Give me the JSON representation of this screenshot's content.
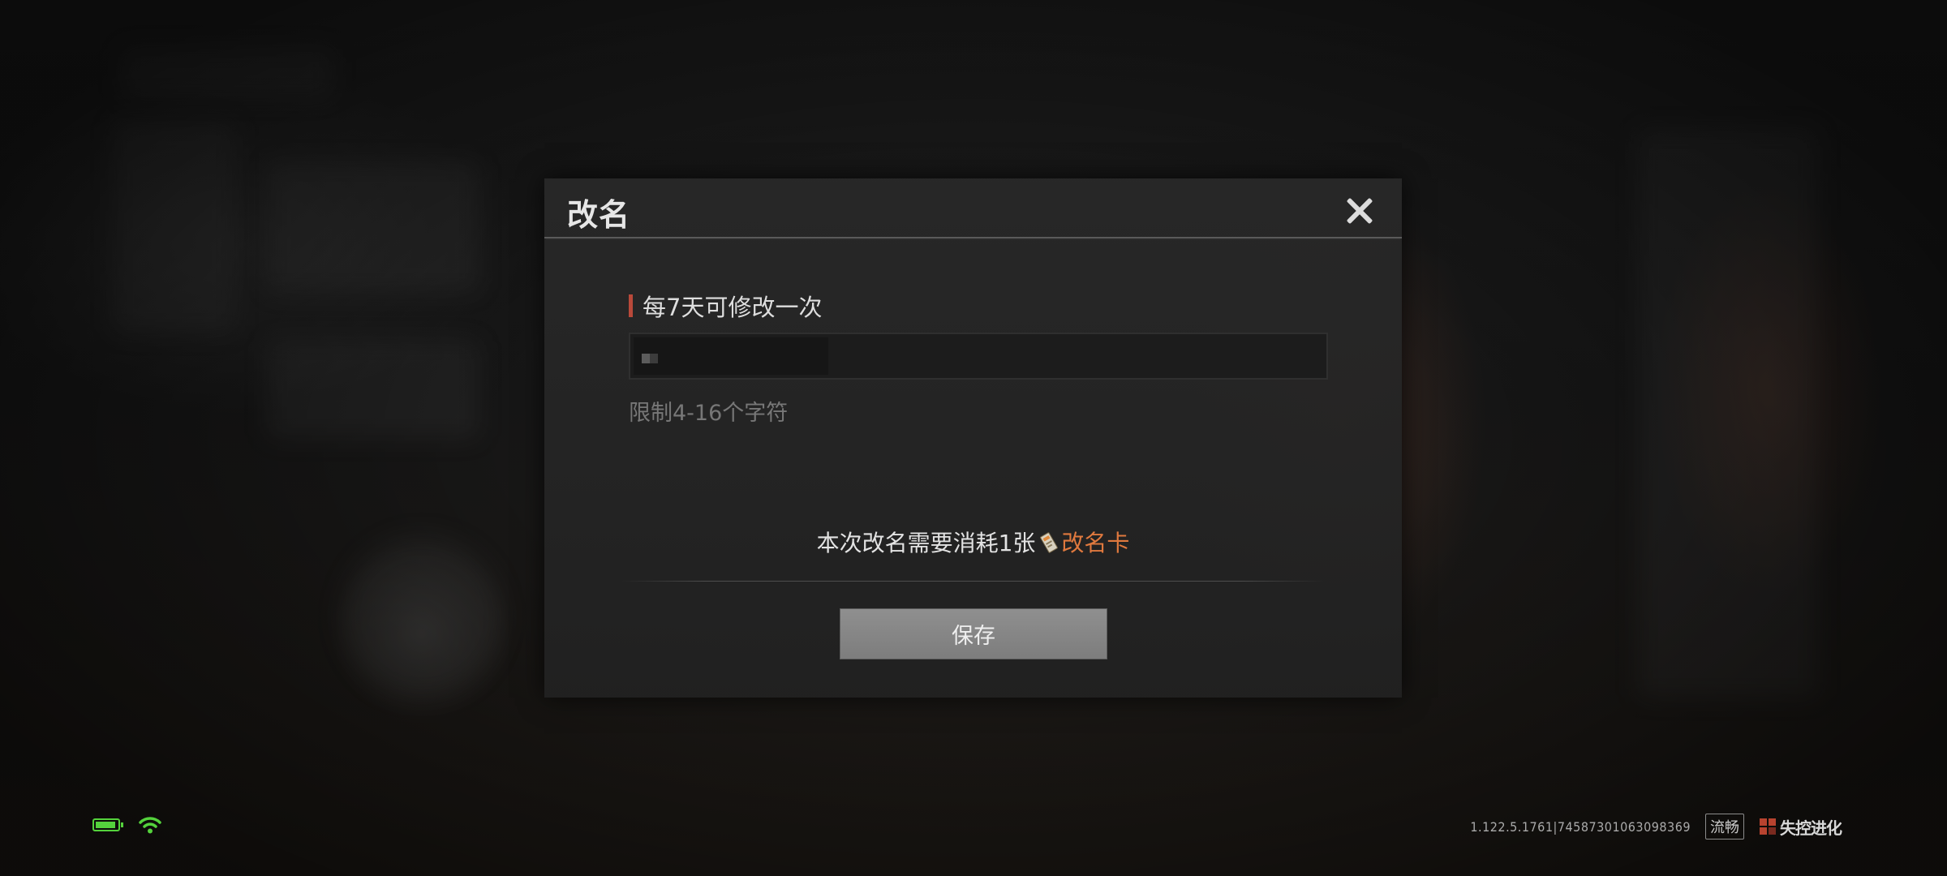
{
  "dialog": {
    "title": "改名",
    "close_icon": "close-icon",
    "field_label": "每7天可修改一次",
    "input_value": "",
    "hint": "限制4-16个字符",
    "cost_prefix": "本次改名需要消耗1张",
    "cost_item_icon": "rename-card-icon",
    "cost_item": "改名卡",
    "save_label": "保存"
  },
  "status": {
    "battery_icon": "battery-icon",
    "wifi_icon": "wifi-icon",
    "version": "1.122.5.1761|7458730106309836​9",
    "quality": "流畅",
    "logo_text": "失控进化"
  },
  "colors": {
    "accent_orange": "#e0793e",
    "label_bar_red": "#b9493a",
    "status_green": "#54d23c"
  }
}
